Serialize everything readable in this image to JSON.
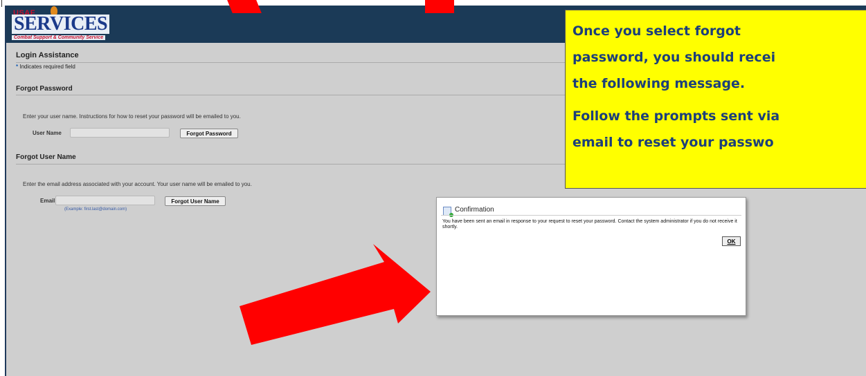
{
  "header": {
    "logo_usaf": "USAF",
    "logo_services": "SERVICES",
    "logo_tagline": "Combat Support & Community Service"
  },
  "login": {
    "title": "Login Assistance",
    "required_asterisk": "*",
    "required_note": "Indicates required field"
  },
  "forgot_password": {
    "title": "Forgot Password",
    "instructions": "Enter your user name. Instructions for how to reset your password will be emailed to you.",
    "field_label": "User Name",
    "field_value": "",
    "button_label": "Forgot Password"
  },
  "forgot_username": {
    "title": "Forgot User Name",
    "instructions": "Enter the email address associated with your account. Your user name will be emailed to you.",
    "field_label": "Email",
    "field_value": "",
    "example": "(Example: first.last@domain.com)",
    "button_label": "Forgot User Name"
  },
  "callout": {
    "lines": [
      "Once you select forgot",
      "password, you should recei",
      "the following message.",
      "Follow the prompts sent via",
      "email to reset your passwo"
    ],
    "background": "#ffff00",
    "text_color": "#1c3f7a"
  },
  "dialog": {
    "icon": "document-check-icon",
    "title": "Confirmation",
    "message": "You have been sent an email in response to your request to reset your password. Contact the system administrator if you do not receive it shortly.",
    "ok_label": "OK"
  },
  "colors": {
    "header": "#1b3a57",
    "page_background": "#cfcfcf",
    "arrow": "#ff0000"
  }
}
